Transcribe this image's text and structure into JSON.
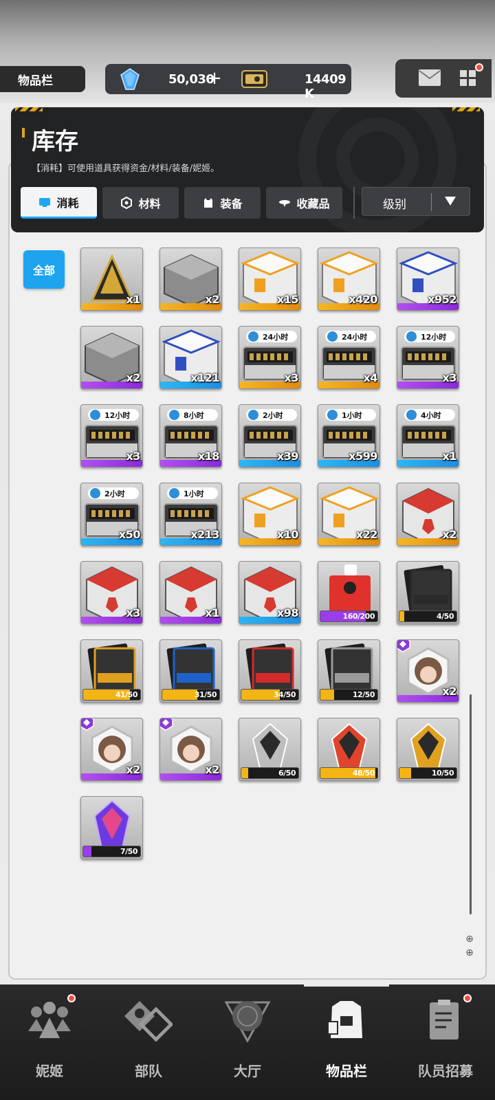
{
  "top_bar": {
    "screen_title": "物品栏",
    "gems": "50,030",
    "gem_add": "+",
    "credits": "14409 K"
  },
  "header": {
    "title": "库存",
    "description": "【消耗】可使用道具获得资金/材料/装备/妮姬。",
    "tabs": [
      {
        "label": "消耗",
        "icon": "consumable-icon",
        "active": true
      },
      {
        "label": "材料",
        "icon": "material-icon",
        "active": false
      },
      {
        "label": "装备",
        "icon": "equipment-icon",
        "active": false
      },
      {
        "label": "收藏品",
        "icon": "collectible-icon",
        "active": false
      }
    ],
    "sort": {
      "label": "级别"
    }
  },
  "filter": {
    "label": "全部"
  },
  "items": [
    {
      "name": "gold-pyramid-ticket",
      "rarity": "gold",
      "qty": "x1"
    },
    {
      "name": "grey-crate",
      "rarity": "gold",
      "qty": "x2"
    },
    {
      "name": "orange-supply-box",
      "rarity": "gold",
      "qty": "x15"
    },
    {
      "name": "orange-supply-box-2",
      "rarity": "gold",
      "qty": "x420"
    },
    {
      "name": "blue-supply-box",
      "rarity": "purple",
      "qty": "x952"
    },
    {
      "name": "grey-crate-2",
      "rarity": "purple",
      "qty": "x2"
    },
    {
      "name": "blue-supply-box-2",
      "rarity": "blue",
      "qty": "x121"
    },
    {
      "name": "time-case-24h",
      "rarity": "gold",
      "qty": "x3",
      "timer": "24小时"
    },
    {
      "name": "time-case-24h-2",
      "rarity": "gold",
      "qty": "x4",
      "timer": "24小时"
    },
    {
      "name": "time-case-12h",
      "rarity": "purple",
      "qty": "x3",
      "timer": "12小时"
    },
    {
      "name": "time-case-12h-2",
      "rarity": "purple",
      "qty": "x3",
      "timer": "12小时"
    },
    {
      "name": "time-case-8h",
      "rarity": "purple",
      "qty": "x18",
      "timer": "8小时"
    },
    {
      "name": "time-case-2h",
      "rarity": "blue",
      "qty": "x39",
      "timer": "2小时"
    },
    {
      "name": "time-case-1h",
      "rarity": "blue",
      "qty": "x599",
      "timer": "1小时"
    },
    {
      "name": "time-case-4h",
      "rarity": "blue",
      "qty": "x1",
      "timer": "4小时"
    },
    {
      "name": "time-case-2h-2",
      "rarity": "blue",
      "qty": "x50",
      "timer": "2小时"
    },
    {
      "name": "time-case-1h-2",
      "rarity": "blue",
      "qty": "x213",
      "timer": "1小时"
    },
    {
      "name": "orange-supply-box-3",
      "rarity": "gold",
      "qty": "x10"
    },
    {
      "name": "orange-supply-box-4",
      "rarity": "gold",
      "qty": "x22"
    },
    {
      "name": "red-cube",
      "rarity": "gold",
      "qty": "x2"
    },
    {
      "name": "red-cube-2",
      "rarity": "purple",
      "qty": "x3"
    },
    {
      "name": "red-cube-3",
      "rarity": "purple",
      "qty": "x1"
    },
    {
      "name": "red-cube-4",
      "rarity": "blue",
      "qty": "x98"
    },
    {
      "name": "lucky-box",
      "rarity": "red",
      "progress": "160/200",
      "progress_value": 0.8,
      "progress_color": "#9b3ee8"
    },
    {
      "name": "black-card-pack",
      "rarity": "gold",
      "progress": "4/50",
      "progress_value": 0.08,
      "progress_color": "#f4b414"
    },
    {
      "name": "tetra-card-pack",
      "rarity": "gold",
      "progress": "41/50",
      "progress_value": 0.82,
      "progress_color": "#f4b414"
    },
    {
      "name": "missilis-card-pack",
      "rarity": "gold",
      "progress": "31/50",
      "progress_value": 0.62,
      "progress_color": "#f4b414"
    },
    {
      "name": "elysion-card-pack",
      "rarity": "gold",
      "progress": "34/50",
      "progress_value": 0.68,
      "progress_color": "#f4b414"
    },
    {
      "name": "pilgrim-card-pack",
      "rarity": "gold",
      "progress": "12/50",
      "progress_value": 0.24,
      "progress_color": "#f4b414"
    },
    {
      "name": "nikke-hex-token",
      "rarity": "purple",
      "qty": "x2",
      "badge": true
    },
    {
      "name": "nikke-hex-token-2",
      "rarity": "purple",
      "qty": "x2",
      "badge": true
    },
    {
      "name": "nikke-hex-token-3",
      "rarity": "purple",
      "qty": "x2",
      "badge": true
    },
    {
      "name": "ssr-crystal-silver",
      "rarity": "gold",
      "progress": "6/50",
      "progress_value": 0.12,
      "progress_color": "#f4b414"
    },
    {
      "name": "ssr-crystal-red",
      "rarity": "gold",
      "progress": "48/50",
      "progress_value": 0.96,
      "progress_color": "#f4b414"
    },
    {
      "name": "ssr-crystal-gold",
      "rarity": "gold",
      "progress": "10/50",
      "progress_value": 0.2,
      "progress_color": "#f4b414"
    },
    {
      "name": "purple-crystal",
      "rarity": "purple",
      "progress": "7/50",
      "progress_value": 0.14,
      "progress_color": "#9b3ee8"
    }
  ],
  "bottom_nav": [
    {
      "label": "妮姬",
      "icon": "nikke-icon",
      "dot": true
    },
    {
      "label": "部队",
      "icon": "squad-icon",
      "dot": false
    },
    {
      "label": "大厅",
      "icon": "lobby-icon",
      "dot": false
    },
    {
      "label": "物品栏",
      "icon": "inventory-icon",
      "dot": false,
      "active": true
    },
    {
      "label": "队员招募",
      "icon": "recruit-icon",
      "dot": true
    }
  ]
}
